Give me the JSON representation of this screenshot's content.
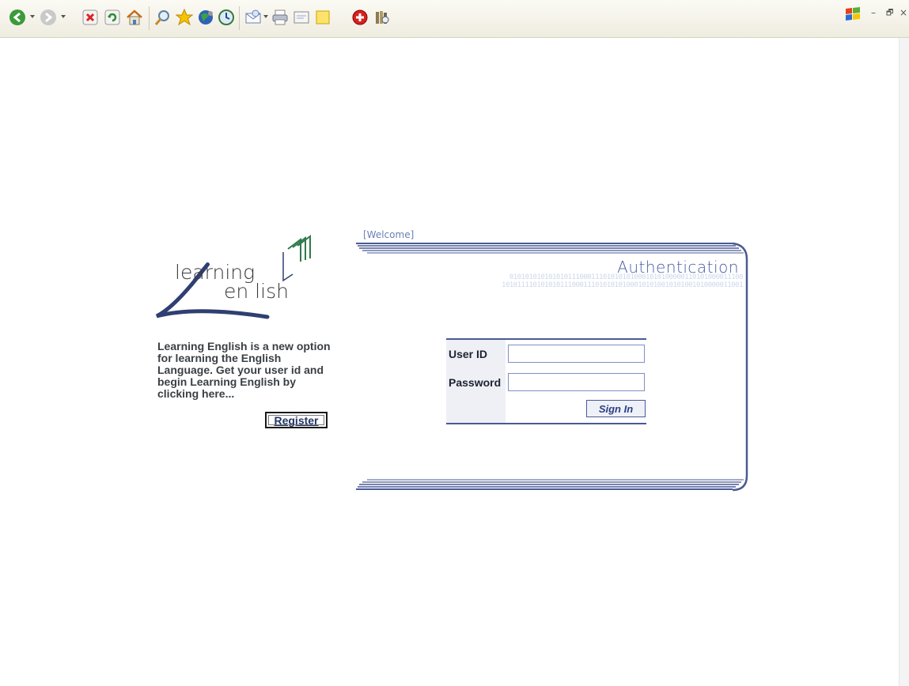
{
  "toolbar": {
    "icons": [
      "back-icon",
      "forward-icon",
      "stop-icon",
      "refresh-icon",
      "home-icon",
      "search-icon",
      "favorites-icon",
      "media-icon",
      "history-icon",
      "mail-icon",
      "print-icon",
      "edit-icon",
      "discuss-icon",
      "add-icon",
      "research-icon"
    ],
    "window_controls": {
      "minimize": "–",
      "restore": "🗗",
      "close": "×"
    }
  },
  "logo": {
    "line1": "learning",
    "line2": "en lish"
  },
  "description": {
    "lines": [
      "Learning English is a new option",
      "for learning the English",
      "Language. Get your user id and",
      "begin Learning English by",
      "clicking here..."
    ],
    "register_label": "Register"
  },
  "panel": {
    "welcome": "[Welcome]",
    "title": "Authentication",
    "binary_line1": "010101010101010111000111010101010001010100000110101000011100",
    "binary_line2": "10101111010101011100011101010101000101010010101001010000011001"
  },
  "form": {
    "userid_label": "User ID",
    "password_label": "Password",
    "userid_value": "",
    "password_value": "",
    "signin_label": "Sign In"
  },
  "colors": {
    "accent": "#2f3e83",
    "panel_border": "#4a5a95",
    "toolbar_bg": "#f4f2e8"
  }
}
